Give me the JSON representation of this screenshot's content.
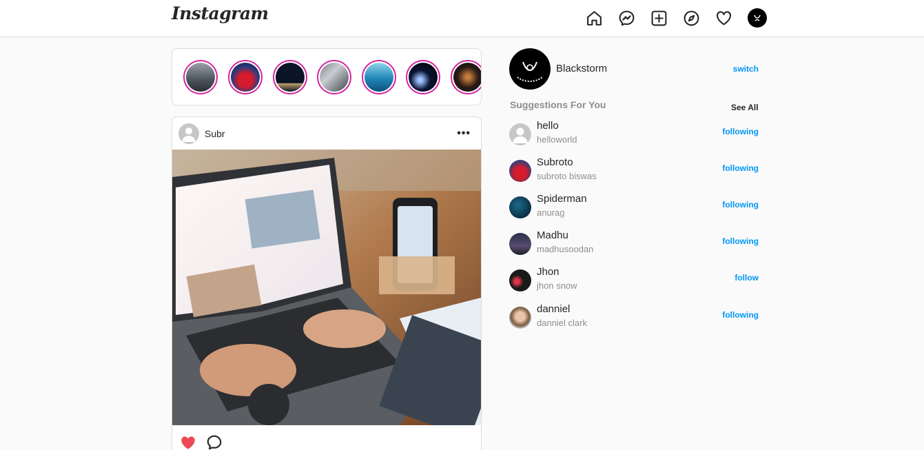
{
  "header": {
    "logo": "Instagram",
    "nav_icons": [
      "home-icon",
      "messenger-icon",
      "new-post-icon",
      "explore-icon",
      "heart-icon",
      "profile-avatar"
    ]
  },
  "stories": [
    {
      "name": "story-1"
    },
    {
      "name": "story-2"
    },
    {
      "name": "story-3"
    },
    {
      "name": "story-4"
    },
    {
      "name": "story-5"
    },
    {
      "name": "story-6"
    },
    {
      "name": "story-7"
    }
  ],
  "post": {
    "username": "Subr",
    "more": "•••",
    "liked": true
  },
  "profile": {
    "name": "Blackstorm",
    "switch_label": "switch"
  },
  "suggestions": {
    "title": "Suggestions For You",
    "see_all": "See All",
    "items": [
      {
        "name": "hello",
        "sub": "helloworld",
        "action": "following"
      },
      {
        "name": "Subroto",
        "sub": "subroto biswas",
        "action": "following"
      },
      {
        "name": "Spiderman",
        "sub": "anurag",
        "action": "following"
      },
      {
        "name": "Madhu",
        "sub": "madhusoodan",
        "action": "following"
      },
      {
        "name": "Jhon",
        "sub": "jhon snow",
        "action": "follow"
      },
      {
        "name": "danniel",
        "sub": "danniel clark",
        "action": "following"
      }
    ]
  },
  "colors": {
    "accent": "#0095f6",
    "story_ring": "#d6249f",
    "like": "#ed4956"
  }
}
